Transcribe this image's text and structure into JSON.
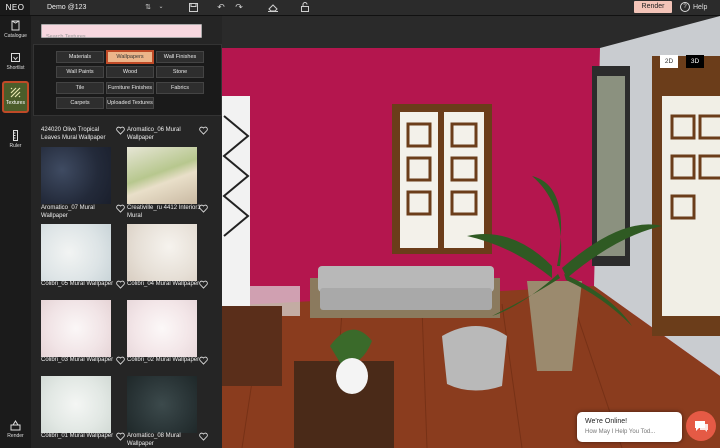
{
  "app": {
    "logo": "NEO",
    "project_name": "Demo @123"
  },
  "toolbar": {
    "render_label": "Render",
    "help_label": "Help"
  },
  "sidebar": {
    "items": [
      {
        "label": "Catalogue",
        "icon": "catalogue-icon"
      },
      {
        "label": "Shortlist",
        "icon": "shortlist-icon"
      },
      {
        "label": "Textures",
        "icon": "textures-icon",
        "active": true
      },
      {
        "label": "Ruler",
        "icon": "ruler-icon"
      },
      {
        "label": "Render",
        "icon": "render-icon"
      }
    ]
  },
  "search": {
    "placeholder": "Search Textures"
  },
  "categories": [
    {
      "label": "Materials"
    },
    {
      "label": "Wallpapers",
      "active": true
    },
    {
      "label": "Wall Finishes"
    },
    {
      "label": "Wall Paints"
    },
    {
      "label": "Wood"
    },
    {
      "label": "Stone"
    },
    {
      "label": "Tile"
    },
    {
      "label": "Furniture Finishes"
    },
    {
      "label": "Fabrics"
    },
    {
      "label": "Carpets"
    },
    {
      "label": "Uploaded Textures"
    }
  ],
  "textures": [
    {
      "name": "424020 Olive Tropical Leaves Mural Wallpaper"
    },
    {
      "name": "Aromatico_06 Mural Wallpaper"
    },
    {
      "name": "Aromatico_07 Mural Wallpaper"
    },
    {
      "name": "Creativille_ru 4412 Interior1 Mural"
    },
    {
      "name": "Colibri_05 Mural Wallpaper"
    },
    {
      "name": "Colibri_04 Mural Wallpaper"
    },
    {
      "name": "Colibri_03 Mural Wallpaper"
    },
    {
      "name": "Colibri_02 Mural Wallpaper"
    },
    {
      "name": "Colibri_01 Mural Wallpaper"
    },
    {
      "name": "Aromatico_08 Mural Wallpaper"
    }
  ],
  "view": {
    "mode_2d": "2D",
    "mode_3d": "3D",
    "active": "3D"
  },
  "chat": {
    "title": "We're Online!",
    "subtitle": "How May I Help You Tod..."
  },
  "colors": {
    "accent": "#c04a27",
    "render_button": "#f3c4b8",
    "wall": "#b4164e",
    "active_category": "#ecb58a"
  }
}
